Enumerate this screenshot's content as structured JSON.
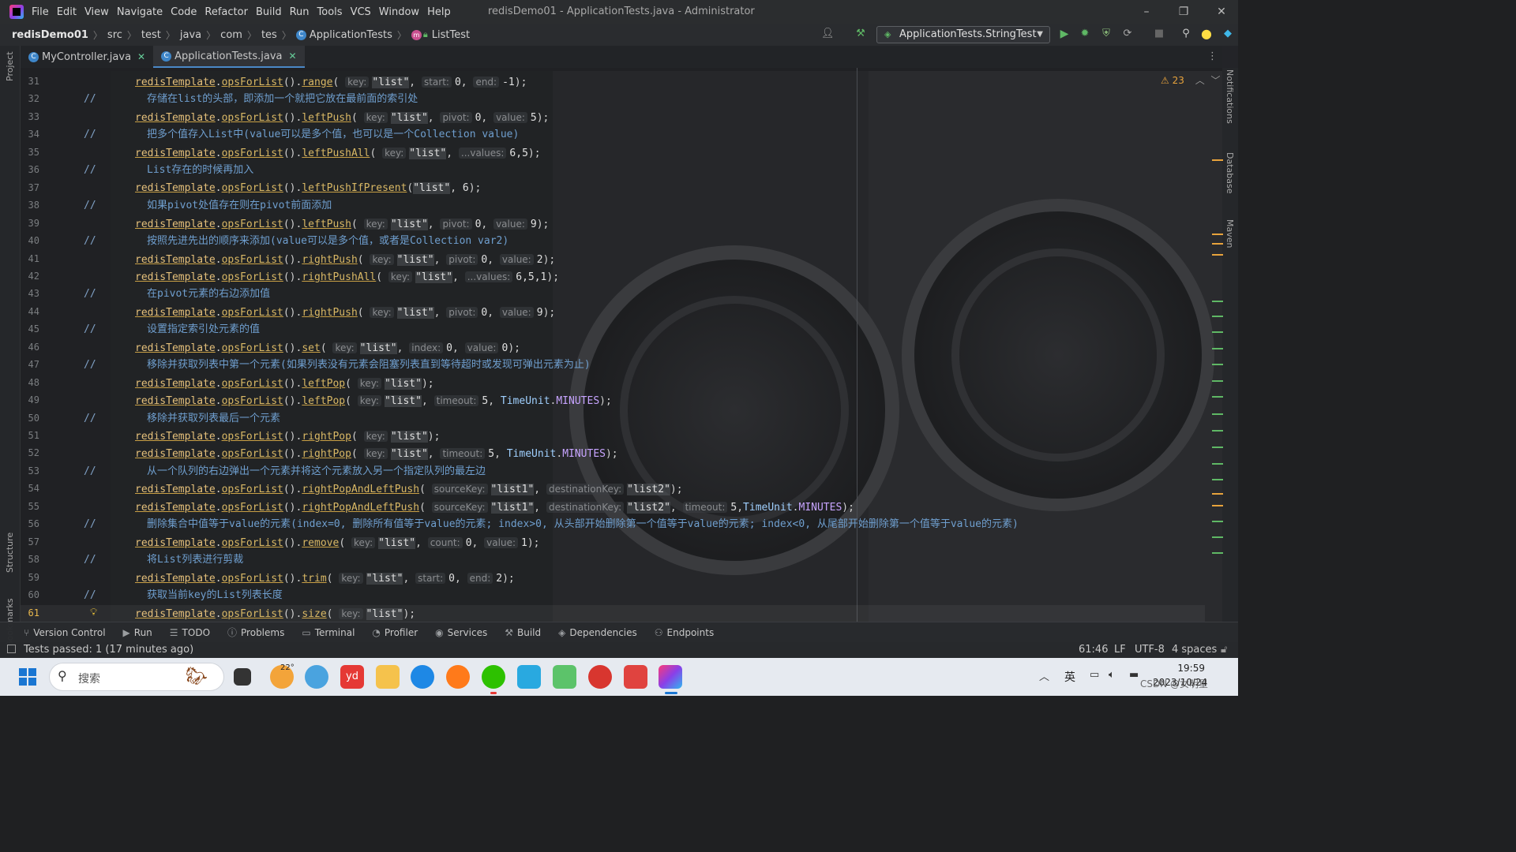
{
  "menu": [
    "File",
    "Edit",
    "View",
    "Navigate",
    "Code",
    "Refactor",
    "Build",
    "Run",
    "Tools",
    "VCS",
    "Window",
    "Help"
  ],
  "window_title": "redisDemo01 - ApplicationTests.java - Administrator",
  "breadcrumbs": [
    "redisDemo01",
    "src",
    "test",
    "java",
    "com",
    "tes",
    "ApplicationTests",
    "ListTest"
  ],
  "run_config": "ApplicationTests.StringTest",
  "tabs": [
    {
      "label": "MyController.java",
      "active": false
    },
    {
      "label": "ApplicationTests.java",
      "active": true
    }
  ],
  "left_tools": [
    "Project",
    "Structure",
    "Bookmarks"
  ],
  "right_tools": [
    "Notifications",
    "Database",
    "Maven"
  ],
  "warnings_count": "23",
  "code_lines": [
    {
      "n": "31",
      "type": "code",
      "tokens": [
        [
          "k",
          "redisTemplate"
        ],
        [
          "p",
          "."
        ],
        [
          "m",
          "opsForList"
        ],
        [
          "p",
          "()."
        ],
        [
          "m",
          "range"
        ],
        [
          "p",
          "( "
        ],
        [
          "h",
          "key:"
        ],
        [
          "s",
          "\"list\""
        ],
        [
          "p",
          ", "
        ],
        [
          "h",
          "start:"
        ],
        [
          "d",
          "0"
        ],
        [
          "p",
          ", "
        ],
        [
          "h",
          "end:"
        ],
        [
          "d",
          "-1"
        ],
        [
          "p",
          ");"
        ]
      ]
    },
    {
      "n": "32",
      "type": "comment",
      "text": "存储在list的头部，即添加一个就把它放在最前面的索引处"
    },
    {
      "n": "33",
      "type": "code",
      "tokens": [
        [
          "k",
          "redisTemplate"
        ],
        [
          "p",
          "."
        ],
        [
          "m",
          "opsForList"
        ],
        [
          "p",
          "()."
        ],
        [
          "m",
          "leftPush"
        ],
        [
          "p",
          "( "
        ],
        [
          "h",
          "key:"
        ],
        [
          "s",
          "\"list\""
        ],
        [
          "p",
          ", "
        ],
        [
          "h",
          "pivot:"
        ],
        [
          "d",
          "0"
        ],
        [
          "p",
          ", "
        ],
        [
          "h",
          "value:"
        ],
        [
          "d",
          "5"
        ],
        [
          "p",
          ");"
        ]
      ]
    },
    {
      "n": "34",
      "type": "comment",
      "text": "把多个值存入List中(value可以是多个值，也可以是一个Collection value)"
    },
    {
      "n": "35",
      "type": "code",
      "tokens": [
        [
          "k",
          "redisTemplate"
        ],
        [
          "p",
          "."
        ],
        [
          "m",
          "opsForList"
        ],
        [
          "p",
          "()."
        ],
        [
          "m",
          "leftPushAll"
        ],
        [
          "p",
          "( "
        ],
        [
          "h",
          "key:"
        ],
        [
          "s",
          "\"list\""
        ],
        [
          "p",
          ", "
        ],
        [
          "h",
          "...values:"
        ],
        [
          "d",
          "6,5"
        ],
        [
          "p",
          ");"
        ]
      ]
    },
    {
      "n": "36",
      "type": "comment",
      "text": "List存在的时候再加入"
    },
    {
      "n": "37",
      "type": "code",
      "tokens": [
        [
          "k",
          "redisTemplate"
        ],
        [
          "p",
          "."
        ],
        [
          "m",
          "opsForList"
        ],
        [
          "p",
          "()."
        ],
        [
          "m",
          "leftPushIfPresent"
        ],
        [
          "p",
          "("
        ],
        [
          "s",
          "\"list\""
        ],
        [
          "p",
          ", "
        ],
        [
          "d",
          "6"
        ],
        [
          "p",
          ");"
        ]
      ]
    },
    {
      "n": "38",
      "type": "comment",
      "text": "如果pivot处值存在则在pivot前面添加"
    },
    {
      "n": "39",
      "type": "code",
      "tokens": [
        [
          "k",
          "redisTemplate"
        ],
        [
          "p",
          "."
        ],
        [
          "m",
          "opsForList"
        ],
        [
          "p",
          "()."
        ],
        [
          "m",
          "leftPush"
        ],
        [
          "p",
          "( "
        ],
        [
          "h",
          "key:"
        ],
        [
          "s",
          "\"list\""
        ],
        [
          "p",
          ", "
        ],
        [
          "h",
          "pivot:"
        ],
        [
          "d",
          "0"
        ],
        [
          "p",
          ", "
        ],
        [
          "h",
          "value:"
        ],
        [
          "d",
          "9"
        ],
        [
          "p",
          ");"
        ]
      ]
    },
    {
      "n": "40",
      "type": "comment",
      "text": "按照先进先出的顺序来添加(value可以是多个值，或者是Collection var2)"
    },
    {
      "n": "41",
      "type": "code",
      "tokens": [
        [
          "k",
          "redisTemplate"
        ],
        [
          "p",
          "."
        ],
        [
          "m",
          "opsForList"
        ],
        [
          "p",
          "()."
        ],
        [
          "m",
          "rightPush"
        ],
        [
          "p",
          "( "
        ],
        [
          "h",
          "key:"
        ],
        [
          "s",
          "\"list\""
        ],
        [
          "p",
          ", "
        ],
        [
          "h",
          "pivot:"
        ],
        [
          "d",
          "0"
        ],
        [
          "p",
          ", "
        ],
        [
          "h",
          "value:"
        ],
        [
          "d",
          "2"
        ],
        [
          "p",
          ");"
        ]
      ]
    },
    {
      "n": "42",
      "type": "code",
      "tokens": [
        [
          "k",
          "redisTemplate"
        ],
        [
          "p",
          "."
        ],
        [
          "m",
          "opsForList"
        ],
        [
          "p",
          "()."
        ],
        [
          "m",
          "rightPushAll"
        ],
        [
          "p",
          "( "
        ],
        [
          "h",
          "key:"
        ],
        [
          "s",
          "\"list\""
        ],
        [
          "p",
          ", "
        ],
        [
          "h",
          "...values:"
        ],
        [
          "d",
          "6,5,1"
        ],
        [
          "p",
          ");"
        ]
      ]
    },
    {
      "n": "43",
      "type": "comment",
      "text": "在pivot元素的右边添加值"
    },
    {
      "n": "44",
      "type": "code",
      "tokens": [
        [
          "k",
          "redisTemplate"
        ],
        [
          "p",
          "."
        ],
        [
          "m",
          "opsForList"
        ],
        [
          "p",
          "()."
        ],
        [
          "m",
          "rightPush"
        ],
        [
          "p",
          "( "
        ],
        [
          "h",
          "key:"
        ],
        [
          "s",
          "\"list\""
        ],
        [
          "p",
          ", "
        ],
        [
          "h",
          "pivot:"
        ],
        [
          "d",
          "0"
        ],
        [
          "p",
          ", "
        ],
        [
          "h",
          "value:"
        ],
        [
          "d",
          "9"
        ],
        [
          "p",
          ");"
        ]
      ]
    },
    {
      "n": "45",
      "type": "comment",
      "text": "设置指定索引处元素的值"
    },
    {
      "n": "46",
      "type": "code",
      "tokens": [
        [
          "k",
          "redisTemplate"
        ],
        [
          "p",
          "."
        ],
        [
          "m",
          "opsForList"
        ],
        [
          "p",
          "()."
        ],
        [
          "m",
          "set"
        ],
        [
          "p",
          "( "
        ],
        [
          "h",
          "key:"
        ],
        [
          "s",
          "\"list\""
        ],
        [
          "p",
          ", "
        ],
        [
          "h",
          "index:"
        ],
        [
          "d",
          "0"
        ],
        [
          "p",
          ", "
        ],
        [
          "h",
          "value:"
        ],
        [
          "d",
          "0"
        ],
        [
          "p",
          ");"
        ]
      ]
    },
    {
      "n": "47",
      "type": "comment",
      "text": "移除并获取列表中第一个元素(如果列表没有元素会阻塞列表直到等待超时或发现可弹出元素为止)"
    },
    {
      "n": "48",
      "type": "code",
      "tokens": [
        [
          "k",
          "redisTemplate"
        ],
        [
          "p",
          "."
        ],
        [
          "m",
          "opsForList"
        ],
        [
          "p",
          "()."
        ],
        [
          "m",
          "leftPop"
        ],
        [
          "p",
          "( "
        ],
        [
          "h",
          "key:"
        ],
        [
          "s",
          "\"list\""
        ],
        [
          "p",
          ");"
        ]
      ]
    },
    {
      "n": "49",
      "type": "code",
      "tokens": [
        [
          "k",
          "redisTemplate"
        ],
        [
          "p",
          "."
        ],
        [
          "m",
          "opsForList"
        ],
        [
          "p",
          "()."
        ],
        [
          "m",
          "leftPop"
        ],
        [
          "p",
          "( "
        ],
        [
          "h",
          "key:"
        ],
        [
          "s",
          "\"list\""
        ],
        [
          "p",
          ", "
        ],
        [
          "h",
          "timeout:"
        ],
        [
          "d",
          "5"
        ],
        [
          "p",
          ", "
        ],
        [
          "c",
          "TimeUnit"
        ],
        [
          "p",
          "."
        ],
        [
          "x",
          "MINUTES"
        ],
        [
          "p",
          ");"
        ]
      ]
    },
    {
      "n": "50",
      "type": "comment",
      "text": "移除并获取列表最后一个元素"
    },
    {
      "n": "51",
      "type": "code",
      "tokens": [
        [
          "k",
          "redisTemplate"
        ],
        [
          "p",
          "."
        ],
        [
          "m",
          "opsForList"
        ],
        [
          "p",
          "()."
        ],
        [
          "m",
          "rightPop"
        ],
        [
          "p",
          "( "
        ],
        [
          "h",
          "key:"
        ],
        [
          "s",
          "\"list\""
        ],
        [
          "p",
          ");"
        ]
      ]
    },
    {
      "n": "52",
      "type": "code",
      "tokens": [
        [
          "k",
          "redisTemplate"
        ],
        [
          "p",
          "."
        ],
        [
          "m",
          "opsForList"
        ],
        [
          "p",
          "()."
        ],
        [
          "m",
          "rightPop"
        ],
        [
          "p",
          "( "
        ],
        [
          "h",
          "key:"
        ],
        [
          "s",
          "\"list\""
        ],
        [
          "p",
          ", "
        ],
        [
          "h",
          "timeout:"
        ],
        [
          "d",
          "5"
        ],
        [
          "p",
          ", "
        ],
        [
          "c",
          "TimeUnit"
        ],
        [
          "p",
          "."
        ],
        [
          "x",
          "MINUTES"
        ],
        [
          "p",
          ");"
        ]
      ]
    },
    {
      "n": "53",
      "type": "comment",
      "text": "从一个队列的右边弹出一个元素并将这个元素放入另一个指定队列的最左边"
    },
    {
      "n": "54",
      "type": "code",
      "tokens": [
        [
          "k",
          "redisTemplate"
        ],
        [
          "p",
          "."
        ],
        [
          "m",
          "opsForList"
        ],
        [
          "p",
          "()."
        ],
        [
          "m",
          "rightPopAndLeftPush"
        ],
        [
          "p",
          "( "
        ],
        [
          "h",
          "sourceKey:"
        ],
        [
          "s",
          "\"list1\""
        ],
        [
          "p",
          ", "
        ],
        [
          "h",
          "destinationKey:"
        ],
        [
          "s",
          "\"list2\""
        ],
        [
          "p",
          ");"
        ]
      ]
    },
    {
      "n": "55",
      "type": "code",
      "tokens": [
        [
          "k",
          "redisTemplate"
        ],
        [
          "p",
          "."
        ],
        [
          "m",
          "opsForList"
        ],
        [
          "p",
          "()."
        ],
        [
          "m",
          "rightPopAndLeftPush"
        ],
        [
          "p",
          "( "
        ],
        [
          "h",
          "sourceKey:"
        ],
        [
          "s",
          "\"list1\""
        ],
        [
          "p",
          ", "
        ],
        [
          "h",
          "destinationKey:"
        ],
        [
          "s",
          "\"list2\""
        ],
        [
          "p",
          ", "
        ],
        [
          "h",
          "timeout:"
        ],
        [
          "d",
          "5"
        ],
        [
          "p",
          ","
        ],
        [
          "c",
          "TimeUnit"
        ],
        [
          "p",
          "."
        ],
        [
          "x",
          "MINUTES"
        ],
        [
          "p",
          ");"
        ]
      ]
    },
    {
      "n": "56",
      "type": "comment",
      "text": "删除集合中值等于value的元素(index=0, 删除所有值等于value的元素; index>0, 从头部开始删除第一个值等于value的元素; index<0, 从尾部开始删除第一个值等于value的元素)"
    },
    {
      "n": "57",
      "type": "code",
      "tokens": [
        [
          "k",
          "redisTemplate"
        ],
        [
          "p",
          "."
        ],
        [
          "m",
          "opsForList"
        ],
        [
          "p",
          "()."
        ],
        [
          "m",
          "remove"
        ],
        [
          "p",
          "( "
        ],
        [
          "h",
          "key:"
        ],
        [
          "s",
          "\"list\""
        ],
        [
          "p",
          ", "
        ],
        [
          "h",
          "count:"
        ],
        [
          "d",
          "0"
        ],
        [
          "p",
          ", "
        ],
        [
          "h",
          "value:"
        ],
        [
          "d",
          "1"
        ],
        [
          "p",
          ");"
        ]
      ]
    },
    {
      "n": "58",
      "type": "comment",
      "text": "将List列表进行剪裁"
    },
    {
      "n": "59",
      "type": "code",
      "tokens": [
        [
          "k",
          "redisTemplate"
        ],
        [
          "p",
          "."
        ],
        [
          "m",
          "opsForList"
        ],
        [
          "p",
          "()."
        ],
        [
          "m",
          "trim"
        ],
        [
          "p",
          "( "
        ],
        [
          "h",
          "key:"
        ],
        [
          "s",
          "\"list\""
        ],
        [
          "p",
          ", "
        ],
        [
          "h",
          "start:"
        ],
        [
          "d",
          "0"
        ],
        [
          "p",
          ", "
        ],
        [
          "h",
          "end:"
        ],
        [
          "d",
          "2"
        ],
        [
          "p",
          ");"
        ]
      ]
    },
    {
      "n": "60",
      "type": "comment",
      "text": "获取当前key的List列表长度"
    },
    {
      "n": "61",
      "type": "code",
      "current": true,
      "tokens": [
        [
          "k",
          "redisTemplate"
        ],
        [
          "p",
          "."
        ],
        [
          "m",
          "opsForList"
        ],
        [
          "p",
          "()."
        ],
        [
          "m",
          "size"
        ],
        [
          "p",
          "( "
        ],
        [
          "h",
          "key:"
        ],
        [
          "s",
          "\"list\""
        ],
        [
          "p",
          ");"
        ]
      ]
    }
  ],
  "comment_prefix": "//",
  "tool_windows": [
    "Version Control",
    "Run",
    "TODO",
    "Problems",
    "Terminal",
    "Profiler",
    "Services",
    "Build",
    "Dependencies",
    "Endpoints"
  ],
  "status": {
    "message": "Tests passed: 1 (17 minutes ago)",
    "position": "61:46",
    "line_sep": "LF",
    "encoding": "UTF-8",
    "indent": "4 spaces"
  },
  "taskbar": {
    "search_placeholder": "搜索",
    "weather": "22°",
    "lang": "英",
    "time": "19:59",
    "date": "2023/10/24",
    "watermark": "CSDN @女明星"
  },
  "colors": {
    "accent": "#4a88c7",
    "keyword": "#e5c07b",
    "comment": "#6f9fcf",
    "warning": "#e8a33c",
    "ok": "#5fb865"
  }
}
